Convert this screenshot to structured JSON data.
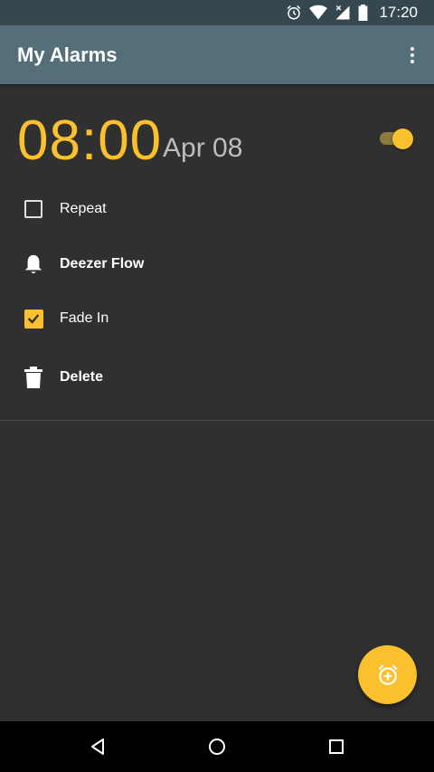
{
  "status_bar": {
    "time": "17:20",
    "icons": [
      "alarm-icon",
      "wifi-icon",
      "signal-icon",
      "battery-icon"
    ]
  },
  "app_bar": {
    "title": "My Alarms",
    "menu_icon": "more-vert-icon"
  },
  "alarm": {
    "time": "08:00",
    "date": "Apr 08",
    "enabled": true,
    "options": [
      {
        "icon": "checkbox-unchecked-icon",
        "label": "Repeat",
        "checked": false
      },
      {
        "icon": "bell-icon",
        "label": "Deezer Flow"
      },
      {
        "icon": "checkbox-checked-icon",
        "label": "Fade In",
        "checked": true
      },
      {
        "icon": "trash-icon",
        "label": "Delete"
      }
    ]
  },
  "fab": {
    "icon": "add-alarm-icon"
  },
  "nav_bar": {
    "buttons": [
      "back-icon",
      "home-icon",
      "recents-icon"
    ]
  },
  "colors": {
    "accent": "#fbc02d",
    "app_bar": "#546e7a",
    "status_bar": "#37474f",
    "background": "#303030"
  }
}
